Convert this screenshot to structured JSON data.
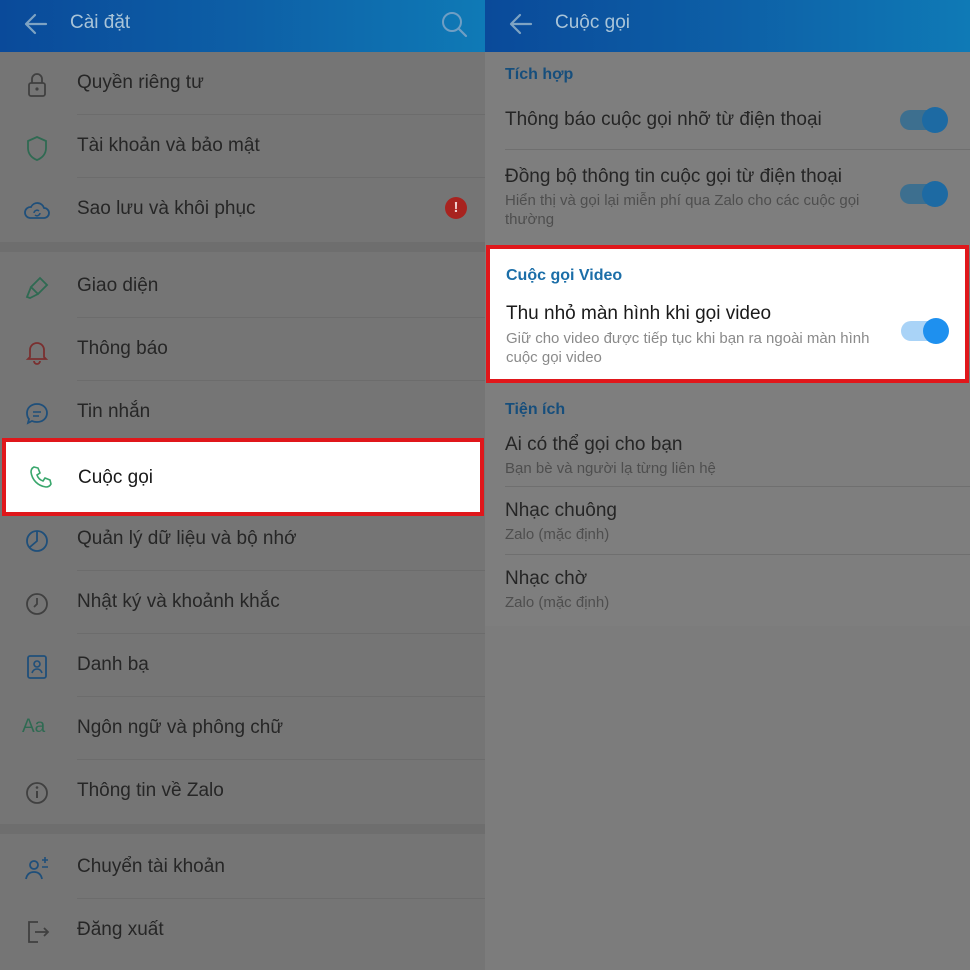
{
  "left": {
    "header": {
      "title": "Cài đặt",
      "back_icon": "back-arrow-icon",
      "search_icon": "search-icon"
    },
    "group1": [
      {
        "label": "Quyền riêng tư",
        "icon": "lock-icon"
      },
      {
        "label": "Tài khoản và bảo mật",
        "icon": "shield-icon"
      },
      {
        "label": "Sao lưu và khôi phục",
        "icon": "cloud-sync-icon",
        "alert": "!"
      }
    ],
    "group2": [
      {
        "label": "Giao diện",
        "icon": "paint-brush-icon"
      },
      {
        "label": "Thông báo",
        "icon": "bell-icon"
      },
      {
        "label": "Tin nhắn",
        "icon": "chat-bubble-icon"
      },
      {
        "label": "Cuộc gọi",
        "icon": "phone-icon"
      },
      {
        "label": "Quản lý dữ liệu và bộ nhớ",
        "icon": "pie-chart-icon"
      },
      {
        "label": "Nhật ký và khoảnh khắc",
        "icon": "clock-icon"
      },
      {
        "label": "Danh bạ",
        "icon": "contact-card-icon"
      },
      {
        "label": "Ngôn ngữ và phông chữ",
        "icon": "font-aa-icon",
        "icon_text": "Aa"
      },
      {
        "label": "Thông tin về Zalo",
        "icon": "info-icon"
      }
    ],
    "group3": [
      {
        "label": "Chuyển tài khoản",
        "icon": "switch-account-icon"
      },
      {
        "label": "Đăng xuất",
        "icon": "logout-icon"
      }
    ]
  },
  "right": {
    "header": {
      "title": "Cuộc gọi",
      "back_icon": "back-arrow-icon"
    },
    "integration": {
      "section_title": "Tích hợp",
      "items": [
        {
          "title": "Thông báo cuộc gọi nhỡ từ điện thoại",
          "subtitle": "",
          "toggle": true
        },
        {
          "title": "Đồng bộ thông tin cuộc gọi từ điện thoại",
          "subtitle": "Hiển thị và gọi lại miễn phí qua Zalo cho các cuộc gọi thường",
          "toggle": true
        }
      ]
    },
    "video": {
      "section_title": "Cuộc gọi Video",
      "title": "Thu nhỏ màn hình khi gọi video",
      "subtitle": "Giữ cho video được tiếp tục khi bạn ra ngoài màn hình cuộc gọi video",
      "toggle": true
    },
    "utilities": {
      "section_title": "Tiện ích",
      "items": [
        {
          "title": "Ai có thể gọi cho bạn",
          "subtitle": "Bạn bè và người lạ từng liên hệ"
        },
        {
          "title": "Nhạc chuông",
          "subtitle": "Zalo (mặc định)"
        },
        {
          "title": "Nhạc chờ",
          "subtitle": "Zalo (mặc định)"
        }
      ]
    }
  },
  "colors": {
    "header_start": "#0a4a9a",
    "header_end": "#0f7ab6",
    "highlight_border": "#e0171b",
    "toggle_on": "#1e90ef",
    "section_blue": "#1b6ea8",
    "alert_red": "#a8231f"
  }
}
